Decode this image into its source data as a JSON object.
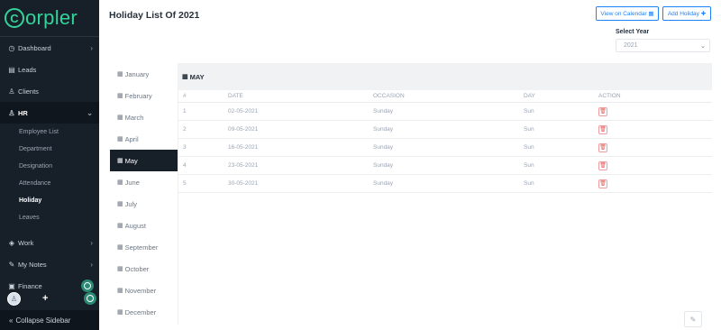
{
  "brand": {
    "logo_letter": "C",
    "name": "orpler"
  },
  "sidebar": {
    "items": [
      {
        "label": "Dashboard",
        "icon": "dashboard-icon",
        "glyph": "◷",
        "chevron": "›"
      },
      {
        "label": "Leads",
        "icon": "document-icon",
        "glyph": "▤",
        "chevron": ""
      },
      {
        "label": "Clients",
        "icon": "clients-icon",
        "glyph": "♙",
        "chevron": ""
      },
      {
        "label": "HR",
        "icon": "person-icon",
        "glyph": "♙",
        "chevron": "⌄"
      }
    ],
    "hr_subitems": [
      "Employee List",
      "Department",
      "Designation",
      "Attendance",
      "Holiday",
      "Leaves"
    ],
    "lower_items": [
      {
        "label": "Work",
        "icon": "layers-icon",
        "glyph": "◈",
        "chevron": "›"
      },
      {
        "label": "My Notes",
        "icon": "notes-icon",
        "glyph": "✎",
        "chevron": "›"
      },
      {
        "label": "Finance",
        "icon": "finance-icon",
        "glyph": "▣",
        "chevron": ""
      }
    ],
    "collapse_label": "Collapse Sidebar",
    "collapse_glyph": "«"
  },
  "header": {
    "title": "Holiday List Of 2021",
    "calendar_button": "View on Calendar ▦",
    "add_button": "Add Holiday ✚",
    "select_year_label": "Select Year",
    "year_value": "2021"
  },
  "months": [
    "January",
    "February",
    "March",
    "April",
    "May",
    "June",
    "July",
    "August",
    "September",
    "October",
    "November",
    "December"
  ],
  "active_month": "May",
  "panel": {
    "heading": "MAY",
    "columns": [
      "#",
      "DATE",
      "OCCASION",
      "DAY",
      "ACTION"
    ],
    "rows": [
      {
        "num": "1",
        "date": "02-05-2021",
        "occasion": "Sunday",
        "day": "Sun"
      },
      {
        "num": "2",
        "date": "09-05-2021",
        "occasion": "Sunday",
        "day": "Sun"
      },
      {
        "num": "3",
        "date": "16-05-2021",
        "occasion": "Sunday",
        "day": "Sun"
      },
      {
        "num": "4",
        "date": "23-05-2021",
        "occasion": "Sunday",
        "day": "Sun"
      },
      {
        "num": "5",
        "date": "30-05-2021",
        "occasion": "Sunday",
        "day": "Sun"
      }
    ]
  },
  "colors": {
    "sidebar": "#171f29",
    "accent_green": "#34d399",
    "primary_blue": "#1d82f5",
    "danger_red": "#e45b5b"
  }
}
